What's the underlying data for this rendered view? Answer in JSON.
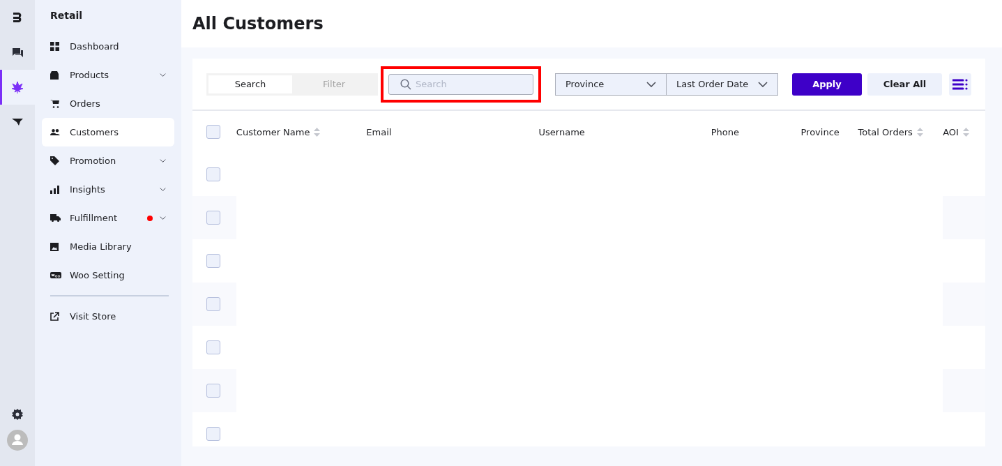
{
  "rail": {
    "items": [
      {
        "selected": false
      },
      {
        "selected": false
      },
      {
        "selected": true
      },
      {
        "selected": false
      }
    ]
  },
  "sidebar": {
    "title": "Retail",
    "items": [
      {
        "label": "Dashboard",
        "expandable": false,
        "selected": false
      },
      {
        "label": "Products",
        "expandable": true,
        "selected": false
      },
      {
        "label": "Orders",
        "expandable": false,
        "selected": false
      },
      {
        "label": "Customers",
        "expandable": false,
        "selected": true
      },
      {
        "label": "Promotion",
        "expandable": true,
        "selected": false
      },
      {
        "label": "Insights",
        "expandable": true,
        "selected": false
      },
      {
        "label": "Fulfillment",
        "expandable": true,
        "selected": false,
        "color": "#ff0000"
      },
      {
        "label": "Media Library",
        "expandable": false,
        "selected": false
      },
      {
        "label": "Woo Setting",
        "expandable": false,
        "selected": false
      }
    ],
    "links": [
      {
        "label": "Visit Store"
      }
    ]
  },
  "page": {
    "title": "All Customers"
  },
  "toolbar": {
    "tabs": [
      {
        "label": "Search",
        "selected": true
      },
      {
        "label": "Filter",
        "selected": false
      }
    ],
    "search": {
      "placeholder": "Search",
      "highlighted": true
    },
    "dropdowns": [
      {
        "label": "Province"
      },
      {
        "label": "Last Order Date"
      }
    ],
    "buttons": [
      {
        "label": "Apply",
        "kind": "primary"
      },
      {
        "label": "Clear All",
        "kind": "secondary"
      }
    ]
  },
  "table": {
    "select_all": {
      "checked": false
    },
    "columns": [
      {
        "label": "Customer Name",
        "sortable": true
      },
      {
        "label": "Email",
        "sortable": false
      },
      {
        "label": "Username",
        "sortable": false
      },
      {
        "label": "Phone",
        "sortable": false
      },
      {
        "label": "Province",
        "sortable": false
      },
      {
        "label": "Total Orders",
        "sortable": true
      },
      {
        "label": "AOI",
        "sortable": true
      }
    ],
    "rows": [
      {
        "checked": false
      },
      {
        "checked": false
      },
      {
        "checked": false
      },
      {
        "checked": false
      },
      {
        "checked": false
      },
      {
        "checked": false
      },
      {
        "checked": false
      }
    ]
  }
}
